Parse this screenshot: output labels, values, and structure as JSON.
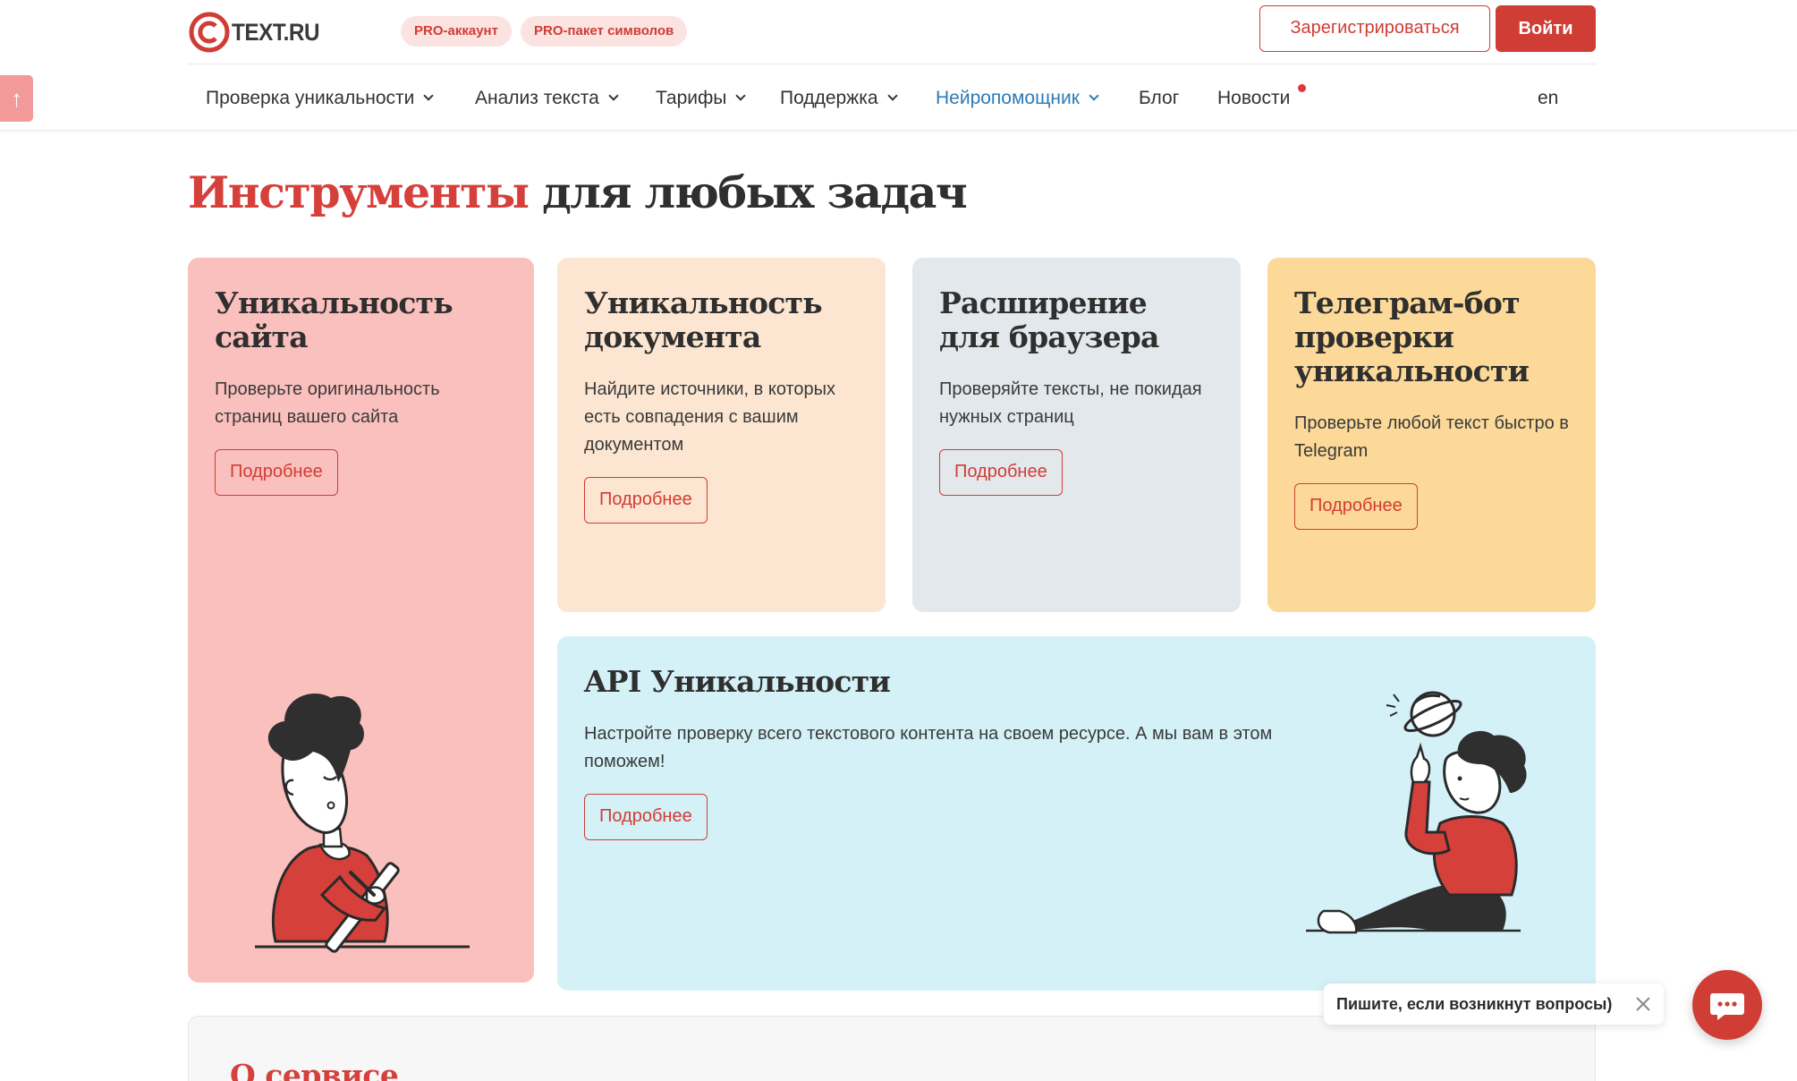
{
  "header": {
    "logo_text": "TEXT.RU",
    "pro_account": "PRO-аккаунт",
    "pro_package": "PRO-пакет символов",
    "register_label": "Зарегистрироваться",
    "login_label": "Войти"
  },
  "nav": {
    "items": [
      {
        "label": "Проверка уникальности",
        "dropdown": true
      },
      {
        "label": "Анализ текста",
        "dropdown": true
      },
      {
        "label": "Тарифы",
        "dropdown": true
      },
      {
        "label": "Поддержка",
        "dropdown": true
      },
      {
        "label": "Нейропомощник",
        "dropdown": true,
        "active": true
      },
      {
        "label": "Блог",
        "dropdown": false
      },
      {
        "label": "Новости",
        "dropdown": false,
        "has_notification": true
      }
    ],
    "lang": "en",
    "scroll_up_icon": "arrow-up-icon"
  },
  "main": {
    "title_accent": "Инструменты",
    "title_rest": " для любых задач",
    "cards": [
      {
        "title": "Уникальность сайта",
        "desc": "Проверьте оригинальность страниц вашего сайта",
        "button": "Подробнее"
      },
      {
        "title": "Уникальность документа",
        "desc": "Найдите источники, в которых есть совпадения с вашим документом",
        "button": "Подробнее"
      },
      {
        "title": "Расширение для браузера",
        "desc": "Проверяйте тексты, не покидая нужных страниц",
        "button": "Подробнее"
      },
      {
        "title": "Телеграм-бот проверки уникальности",
        "desc": "Проверьте любой текст быстро в Telegram",
        "button": "Подробнее"
      },
      {
        "title": "API Уникальности",
        "desc": "Настройте проверку всего текстового контента на своем ресурсе. А мы вам в этом поможем!",
        "button": "Подробнее"
      }
    ]
  },
  "about": {
    "title": "О сервисе"
  },
  "chat": {
    "tooltip": "Пишите, если возникнут вопросы)",
    "icon": "chat-bubble-icon"
  },
  "colors": {
    "accent": "#d03d34",
    "link_active": "#2d7bb4",
    "card_site": "#fac0bd",
    "card_doc": "#fce6d1",
    "card_ext": "#e3e8ec",
    "card_tg": "#fcd998",
    "card_api": "#d5f1f8"
  }
}
